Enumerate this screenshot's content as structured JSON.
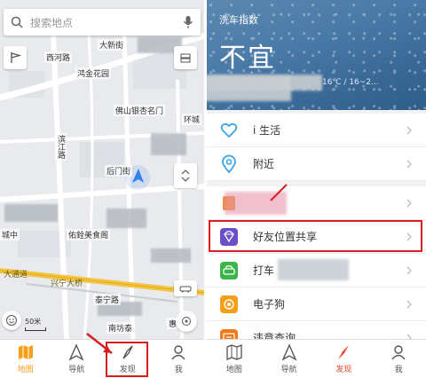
{
  "left_panel": {
    "search": {
      "placeholder": "搜索地点"
    },
    "map_labels": {
      "xiyongli": "西河路",
      "baiyun": "大新街",
      "hongyuan": "鸿金花园",
      "gate": "佛山银杏名门",
      "huanhu": "环城",
      "vertical_road": "滨江路",
      "mid_road": "后门街",
      "city_center": "城中",
      "youjin": "佑銓美食阁",
      "taining": "大通道",
      "xingfu": "兴宁大桥",
      "taining2": "泰宁路",
      "nanhai": "南坊泰",
      "hui": "惠"
    },
    "scale_text": "50米",
    "tabs": [
      {
        "label": "地图",
        "icon": "map-icon"
      },
      {
        "label": "导航",
        "icon": "navigation-icon"
      },
      {
        "label": "发现",
        "icon": "compass-icon"
      },
      {
        "label": "我",
        "icon": "user-icon"
      }
    ],
    "active_tab": "地图"
  },
  "right_panel": {
    "hero": {
      "small_label": "洗车指数",
      "big_label": "不宜",
      "weather": "16℃ / 16~2..."
    },
    "items": [
      {
        "label": "i 生活",
        "icon": "heart-icon",
        "color": "#3ba3e8"
      },
      {
        "label": "附近",
        "icon": "location-pin-icon",
        "color": "#3ba3e8"
      },
      {
        "label": "",
        "icon": "orange-tag-icon",
        "color": "#f08a2c"
      },
      {
        "label": "好友位置共享",
        "icon": "diamond-icon",
        "color": "#6b4fc8"
      },
      {
        "label": "打车",
        "icon": "car-icon",
        "color": "#3bb54a"
      },
      {
        "label": "电子狗",
        "icon": "camera-eye-icon",
        "color": "#f5a01a"
      },
      {
        "label": "违章查询",
        "icon": "ticket-icon",
        "color": "#f07a1a"
      }
    ],
    "tabs": [
      {
        "label": "地图",
        "icon": "map-icon"
      },
      {
        "label": "导航",
        "icon": "navigation-icon"
      },
      {
        "label": "发现",
        "icon": "compass-icon"
      },
      {
        "label": "我",
        "icon": "user-icon"
      }
    ],
    "active_tab": "发现"
  },
  "colors": {
    "accent_orange": "#f5a01a",
    "discover_red": "#e84a2e",
    "highlight_red": "#d81e1e",
    "hero_blue": "#4a7aa8"
  }
}
